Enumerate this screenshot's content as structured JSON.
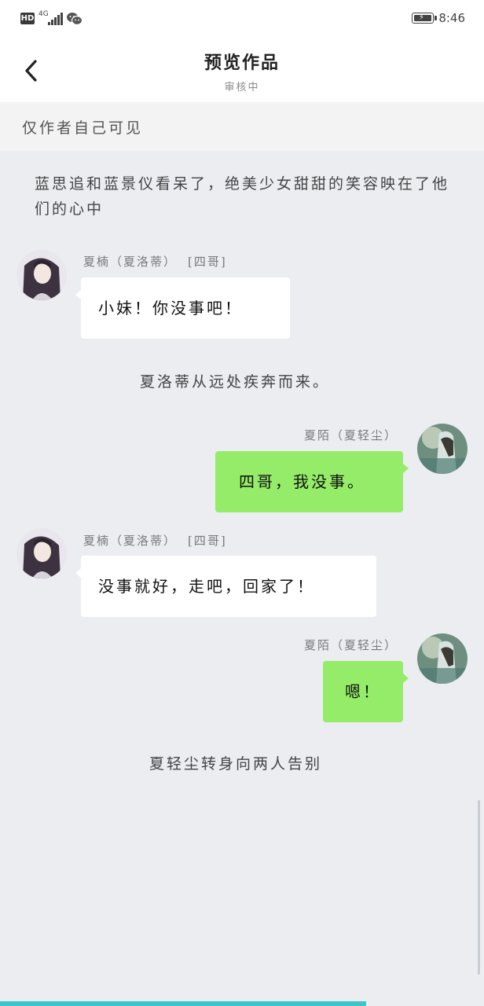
{
  "status_bar": {
    "hd_label": "HD",
    "network": "4G",
    "time": "8:46",
    "icons": [
      "hd-icon",
      "signal-icon",
      "wechat-icon",
      "battery-icon"
    ]
  },
  "header": {
    "title": "预览作品",
    "subtitle": "审核中"
  },
  "notice": "仅作者自己可见",
  "messages": [
    {
      "type": "narration",
      "text": "蓝思追和蓝景仪看呆了，绝美少女甜甜的笑容映在了他们的心中"
    },
    {
      "type": "left",
      "name": "夏楠（夏洛蒂）",
      "tag": "[四哥]",
      "text": "小妹！你没事吧！"
    },
    {
      "type": "narration",
      "text": "夏洛蒂从远处疾奔而来。"
    },
    {
      "type": "right",
      "name": "夏陌（夏轻尘）",
      "text": "四哥，我没事。"
    },
    {
      "type": "left",
      "name": "夏楠（夏洛蒂）",
      "tag": "[四哥]",
      "text": "没事就好，走吧，回家了！"
    },
    {
      "type": "right",
      "name": "夏陌（夏轻尘）",
      "text": "嗯！"
    },
    {
      "type": "narration",
      "text": "夏轻尘转身向两人告别"
    }
  ],
  "colors": {
    "background": "#ebedf1",
    "self_bubble": "#95ec69",
    "other_bubble": "#ffffff",
    "progress": "#3cc6c9"
  },
  "reading_progress": 0.757
}
